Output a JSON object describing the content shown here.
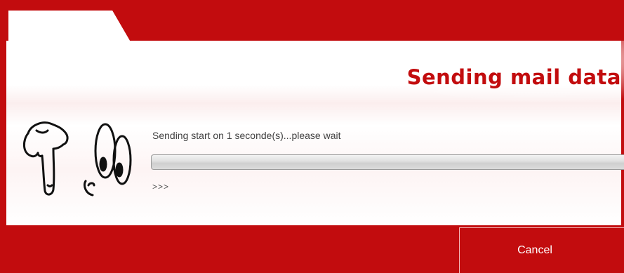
{
  "window": {
    "title": "Sending mail data"
  },
  "status": {
    "message": "Sending start on 1 seconde(s)...please wait",
    "progress_fraction": 0,
    "detail": ">>>"
  },
  "actions": {
    "cancel_label": "Cancel"
  },
  "icons": {
    "mascot": "pointing-hand-with-eyes-icon"
  },
  "colors": {
    "brand_red": "#c20c0e",
    "text_gray": "#404040",
    "progress_track": "#d9d9d9"
  }
}
